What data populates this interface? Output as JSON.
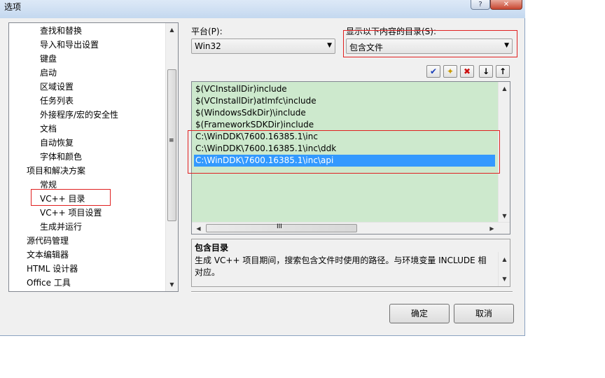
{
  "window": {
    "title": "选项",
    "help_glyph": "?",
    "close_glyph": "✕"
  },
  "tree": {
    "items": [
      {
        "label": "查找和替换",
        "level": 1
      },
      {
        "label": "导入和导出设置",
        "level": 1
      },
      {
        "label": "键盘",
        "level": 1
      },
      {
        "label": "启动",
        "level": 1
      },
      {
        "label": "区域设置",
        "level": 1
      },
      {
        "label": "任务列表",
        "level": 1
      },
      {
        "label": "外接程序/宏的安全性",
        "level": 1
      },
      {
        "label": "文档",
        "level": 1
      },
      {
        "label": "自动恢复",
        "level": 1
      },
      {
        "label": "字体和颜色",
        "level": 1
      },
      {
        "label": "项目和解决方案",
        "level": 0
      },
      {
        "label": "常规",
        "level": 1
      },
      {
        "label": "VC++ 目录",
        "level": 1,
        "selected": true
      },
      {
        "label": "VC++ 项目设置",
        "level": 1
      },
      {
        "label": "生成并运行",
        "level": 1
      },
      {
        "label": "源代码管理",
        "level": 0
      },
      {
        "label": "文本编辑器",
        "level": 0
      },
      {
        "label": "HTML 设计器",
        "level": 0
      },
      {
        "label": "Office 工具",
        "level": 0
      }
    ]
  },
  "platform": {
    "label": "平台(P):",
    "value": "Win32"
  },
  "show_dirs": {
    "label": "显示以下内容的目录(S):",
    "value": "包含文件"
  },
  "toolbar": {
    "check_glyph": "✔",
    "newfolder_glyph": "✦",
    "delete_glyph": "✖",
    "down_glyph": "↓",
    "up_glyph": "↑"
  },
  "dirlist": {
    "items": [
      {
        "path": "$(VCInstallDir)include"
      },
      {
        "path": "$(VCInstallDir)atlmfc\\include"
      },
      {
        "path": "$(WindowsSdkDir)\\include"
      },
      {
        "path": "$(FrameworkSDKDir)include"
      },
      {
        "path": "C:\\WinDDK\\7600.16385.1\\inc"
      },
      {
        "path": "C:\\WinDDK\\7600.16385.1\\inc\\ddk"
      },
      {
        "path": "C:\\WinDDK\\7600.16385.1\\inc\\api",
        "selected": true
      }
    ],
    "hscroll_grip": "III"
  },
  "description": {
    "title": "包含目录",
    "text_line1": "生成 VC++ 项目期间，搜索包含文件时使用的路径。与环境变量 INCLUDE 相",
    "text_line2": "对应。"
  },
  "buttons": {
    "ok": "确定",
    "cancel": "取消"
  },
  "scroll": {
    "up": "▲",
    "down": "▼",
    "left": "◀",
    "right": "▶",
    "grip": "≡"
  },
  "combo_arrow": "▼",
  "colors": {
    "annotation": "#e02020",
    "list_bg": "#cde9cd",
    "selection": "#3399ff"
  }
}
